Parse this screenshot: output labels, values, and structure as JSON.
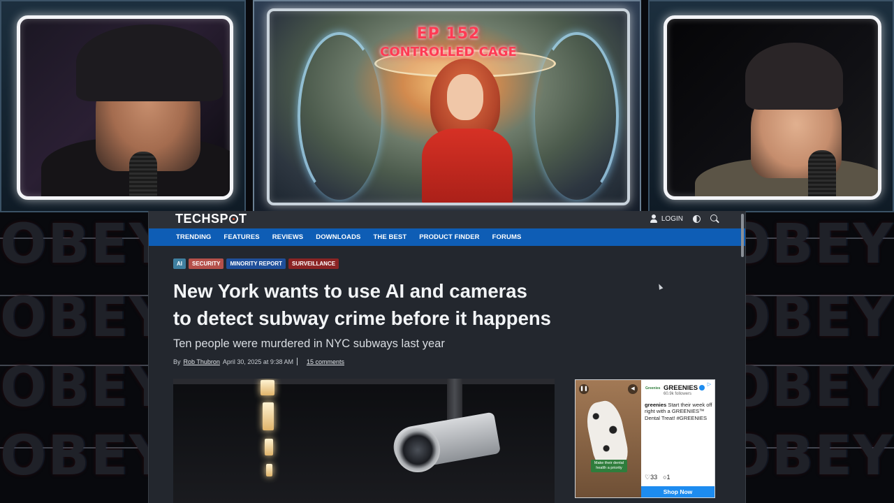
{
  "stream": {
    "episode_number": "EP 152",
    "episode_title": "CONTROLLED CAGE",
    "background_word": "OBEY"
  },
  "site": {
    "logo": "TECHSPOT",
    "login_label": "LOGIN",
    "nav": [
      "TRENDING",
      "FEATURES",
      "REVIEWS",
      "DOWNLOADS",
      "THE BEST",
      "PRODUCT FINDER",
      "FORUMS"
    ],
    "tags": [
      {
        "label": "AI",
        "color": "#3f7fa0"
      },
      {
        "label": "SECURITY",
        "color": "#b5504a"
      },
      {
        "label": "MINORITY REPORT",
        "color": "#1f4f9a"
      },
      {
        "label": "SURVEILLANCE",
        "color": "#8b2424"
      }
    ],
    "accent_color": "#0e5db5"
  },
  "article": {
    "headline_line1": "New York wants to use AI and cameras",
    "headline_line2": "to detect subway crime before it happens",
    "subhead": "Ten people were murdered in NYC subways last year",
    "by": "By",
    "author": "Rob Thubron",
    "date": "April 30, 2025 at 9:38 AM",
    "comments": "15 comments"
  },
  "ad": {
    "brand": "GREENIES",
    "followers": "60.9k followers",
    "account": "greenies",
    "text": "Start their week off right with a GREENIES™ Dental Treat! #GREENIES",
    "likes": "33",
    "replies": "1",
    "cta": "Shop Now",
    "image_caption": "Make their dental health a priority",
    "logo_text": "Greenies"
  },
  "icons": [
    "user-icon",
    "theme-toggle-icon",
    "search-icon",
    "pause-icon",
    "mute-icon",
    "ad-info-icon",
    "heart-icon",
    "comment-icon"
  ]
}
